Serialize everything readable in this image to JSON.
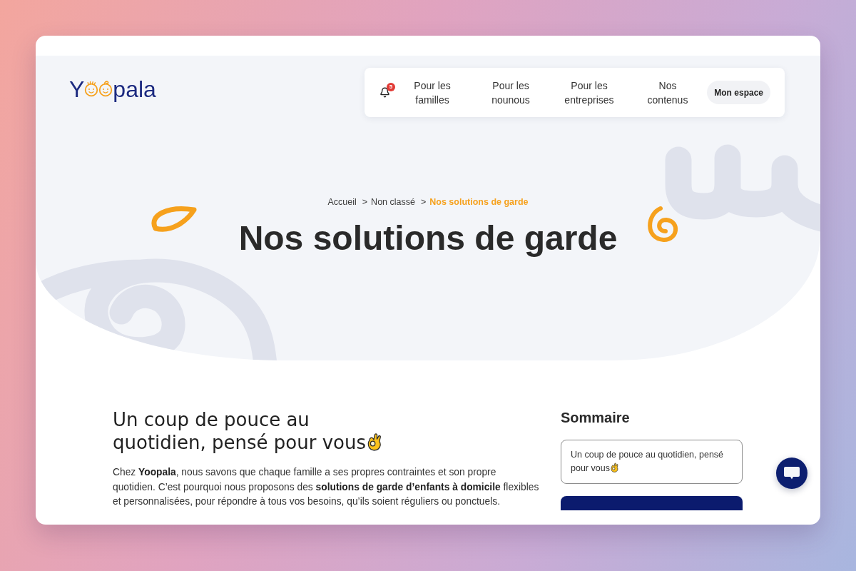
{
  "logo": {
    "text_before": "Y",
    "text_after": "pala"
  },
  "nav": {
    "notification_count": "5",
    "links": [
      "Pour les familles",
      "Pour les nounous",
      "Pour les entreprises",
      "Nos contenus"
    ],
    "account_button": "Mon espace"
  },
  "breadcrumb": [
    {
      "label": "Accueil",
      "current": false
    },
    {
      "separator": ">",
      "label": "Non classé",
      "current": false
    },
    {
      "separator": ">",
      "label": "Nos solutions de garde",
      "current": true
    }
  ],
  "title": "Nos solutions de garde",
  "article": {
    "heading": "Un coup de pouce au quotidien, pensé pour vous",
    "intro": "Chez **Yoopala**, nous savons que chaque famille a ses propres contraintes et son propre quotidien. C’est pourquoi nous proposons des **solutions de garde d’enfants à domicile** flexibles et personnalisées, pour répondre à tous vos besoins, qu’ils soient réguliers ou ponctuels."
  },
  "sidebar": {
    "title": "Sommaire",
    "toc": [
      {
        "label": "Un coup de pouce au quotidien, pensé pour vous"
      }
    ]
  }
}
